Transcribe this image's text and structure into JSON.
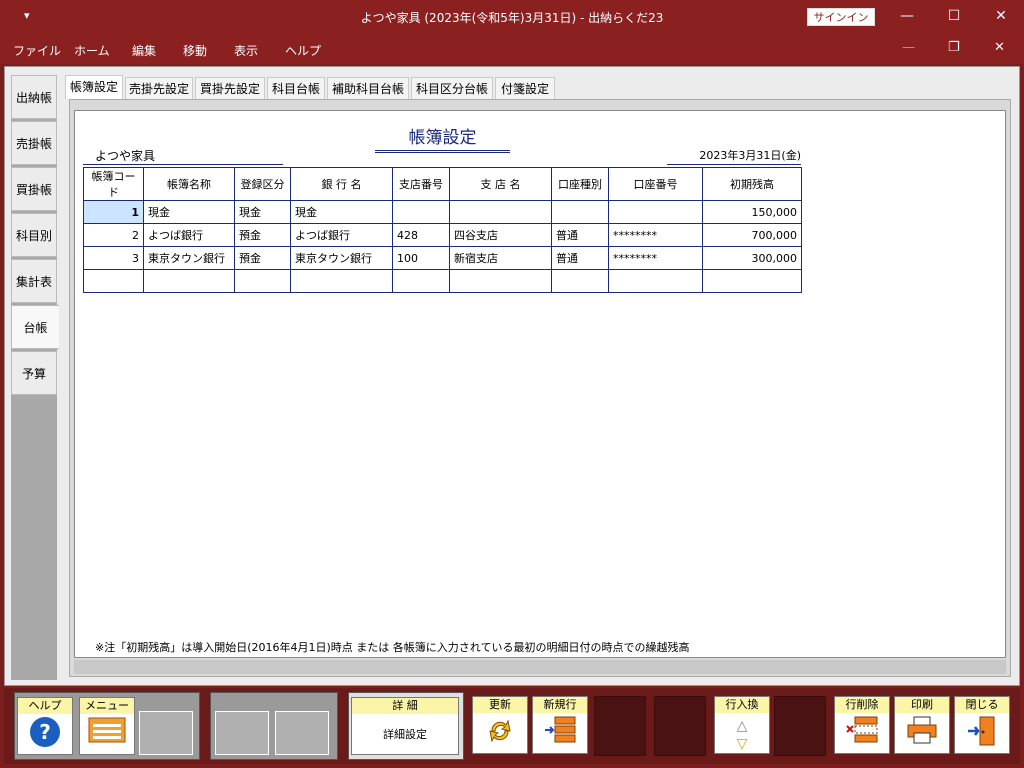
{
  "window": {
    "quick_access": "▾",
    "title": "よつや家具 (2023年(令和5年)3月31日)  -  出納らくだ23",
    "signin": "サインイン"
  },
  "menu": [
    "ファイル",
    "ホーム",
    "編集",
    "移動",
    "表示",
    "ヘルプ"
  ],
  "side_tabs": [
    "出納帳",
    "売掛帳",
    "買掛帳",
    "科目別",
    "集計表",
    "台帳",
    "予算"
  ],
  "active_side_tab": "台帳",
  "top_tabs": [
    "帳簿設定",
    "売掛先設定",
    "買掛先設定",
    "科目台帳",
    "補助科目台帳",
    "科目区分台帳",
    "付箋設定"
  ],
  "sheet": {
    "title": "帳簿設定",
    "company": "よつや家具",
    "date": "2023年3月31日(金)",
    "columns": [
      "帳簿コード",
      "帳簿名称",
      "登録区分",
      "銀 行 名",
      "支店番号",
      "支 店 名",
      "口座種別",
      "口座番号",
      "初期残高"
    ],
    "rows": [
      [
        "1",
        "現金",
        "現金",
        "現金",
        "",
        "",
        "",
        "",
        "150,000"
      ],
      [
        "2",
        "よつば銀行",
        "預金",
        "よつば銀行",
        "428",
        "四谷支店",
        "普通",
        "********",
        "700,000"
      ],
      [
        "3",
        "東京タウン銀行",
        "預金",
        "東京タウン銀行",
        "100",
        "新宿支店",
        "普通",
        "********",
        "300,000"
      ],
      [
        "",
        "",
        "",
        "",
        "",
        "",
        "",
        "",
        ""
      ]
    ],
    "note": "※注「初期残高」は導入開始日(2016年4月1日)時点 または 各帳簿に入力されている最初の明細日付の時点での繰越残高"
  },
  "bottom": {
    "help": "ヘルプ",
    "menu": "メニュー",
    "detail_label": "詳 細",
    "detail_button": "詳細設定",
    "update": "更新",
    "new_row": "新規行",
    "row_swap": "行入換",
    "row_delete": "行削除",
    "print": "印刷",
    "close": "閉じる"
  }
}
